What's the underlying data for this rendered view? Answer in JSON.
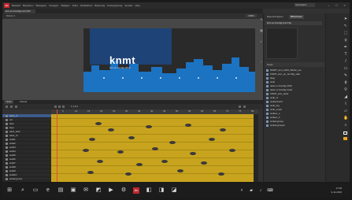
{
  "menubar": {
    "logo_text": "An",
    "items": [
      "Bestand",
      "Bewerken",
      "Weergave",
      "Invoegen",
      "Wijzigen",
      "Tekst",
      "Opdrachten",
      "Besturing",
      "Foutopsporing",
      "Venster",
      "Help"
    ],
    "workspace": "Standaard",
    "minimize": "–",
    "maximize": "□",
    "close": "×"
  },
  "document": {
    "tab_label": "kort-en-bondig-knmt.fla*",
    "scene_label": "Scène 1",
    "zoom": "100%"
  },
  "stage": {
    "logo": "knmt",
    "tagline": "kort en bondig 2016"
  },
  "timeline": {
    "tabs": [
      "Tijdlijn",
      "Uitvoer"
    ],
    "frame_counter": "1    1,0 s",
    "ruler_numbers": [
      "5",
      "10",
      "15",
      "20",
      "25",
      "30",
      "35",
      "40",
      "45",
      "50",
      "55",
      "60",
      "65",
      "70",
      "75",
      "80"
    ],
    "layers": [
      "tekst_r1",
      "wit",
      "blok",
      "logo",
      "tekst_blok",
      "tekst_r2",
      "wolk1",
      "wolk2",
      "wolk3",
      "wolk4",
      "wolk5",
      "wolk6",
      "wolk7",
      "wolk8",
      "wolk9",
      "wolk10",
      "achtergrond"
    ]
  },
  "panels": {
    "tabs": [
      "Eigenschappen",
      "Bibliotheek"
    ],
    "library_file": "kort-en-bondig-knmt.fla",
    "library_header": "Naam",
    "library_items": [
      "NMMT_kort_2016_58x22_ser",
      "KNMT_kort_en_bondig_vlak",
      "laag",
      "wolk",
      "tekst en bondig 2016",
      "tekst en bondig zwart",
      "KNMT_kort_tekst",
      "wolk_r1",
      "wolkenlucht",
      "wolk_big",
      "wolk_small",
      "wolken_s",
      "wolken_b",
      "wolkengroep",
      "wolkengroep2"
    ]
  },
  "colors": {
    "stroke": "#ffffff",
    "fill": "#e8a61a",
    "accent_red": "#c1272d"
  },
  "taskbar": {
    "time": "17:08",
    "date": "9-11-2016"
  }
}
